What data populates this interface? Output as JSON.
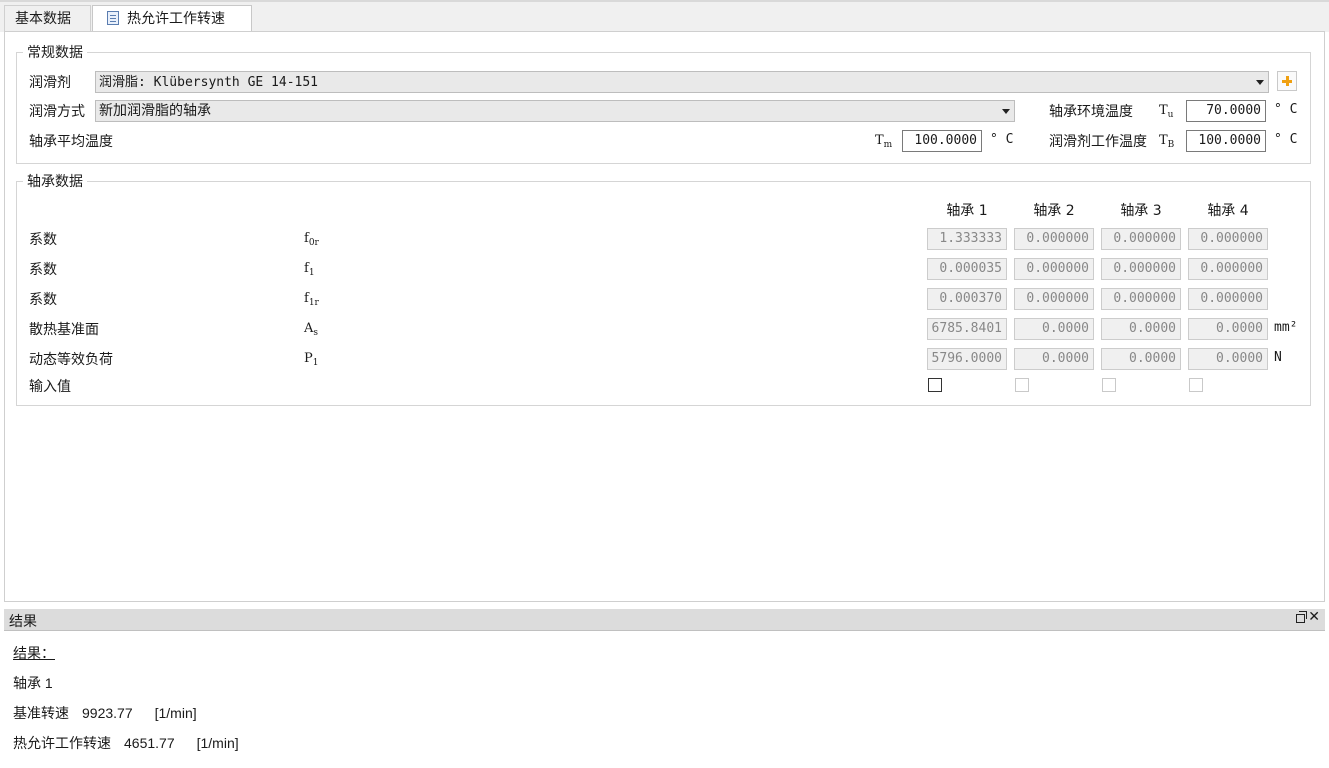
{
  "tabs": [
    {
      "label": "基本数据"
    },
    {
      "label": "热允许工作转速"
    }
  ],
  "general": {
    "legend": "常规数据",
    "lubricant_label": "润滑剂",
    "lubricant_value": "润滑脂: Klübersynth GE 14-151",
    "lubrication_method_label": "润滑方式",
    "lubrication_method_value": "新加润滑脂的轴承",
    "ambient_temp_label": "轴承环境温度",
    "ambient_temp_symbol": "T",
    "ambient_temp_sub": "u",
    "ambient_temp_value": "70.0000",
    "mean_temp_label": "轴承平均温度",
    "mean_temp_symbol": "T",
    "mean_temp_sub": "m",
    "mean_temp_value": "100.0000",
    "lub_work_temp_label": "润滑剂工作温度",
    "lub_work_temp_symbol": "T",
    "lub_work_temp_sub": "B",
    "lub_work_temp_value": "100.0000",
    "temp_unit": "° C"
  },
  "bearing": {
    "legend": "轴承数据",
    "columns": [
      "轴承 1",
      "轴承 2",
      "轴承 3",
      "轴承 4"
    ],
    "rows": [
      {
        "label": "系数",
        "symbol": "f",
        "sub": "0r",
        "values": [
          "1.333333",
          "0.000000",
          "0.000000",
          "0.000000"
        ],
        "unit": ""
      },
      {
        "label": "系数",
        "symbol": "f",
        "sub": "1",
        "values": [
          "0.000035",
          "0.000000",
          "0.000000",
          "0.000000"
        ],
        "unit": ""
      },
      {
        "label": "系数",
        "symbol": "f",
        "sub": "1r",
        "values": [
          "0.000370",
          "0.000000",
          "0.000000",
          "0.000000"
        ],
        "unit": ""
      },
      {
        "label": "散热基准面",
        "symbol": "A",
        "sub": "s",
        "values": [
          "6785.8401",
          "0.0000",
          "0.0000",
          "0.0000"
        ],
        "unit": "mm²"
      },
      {
        "label": "动态等效负荷",
        "symbol": "P",
        "sub": "1",
        "values": [
          "5796.0000",
          "0.0000",
          "0.0000",
          "0.0000"
        ],
        "unit": "N"
      }
    ],
    "input_label": "输入值"
  },
  "results": {
    "dock_title": "结果",
    "heading": "结果：",
    "bearing_name": "轴承 1",
    "ref_speed_label": "基准转速",
    "ref_speed_value": "9923.77",
    "ref_speed_unit": "[1/min]",
    "thermal_speed_label": "热允许工作转速",
    "thermal_speed_value": "4651.77",
    "thermal_speed_unit": "[1/min]"
  }
}
